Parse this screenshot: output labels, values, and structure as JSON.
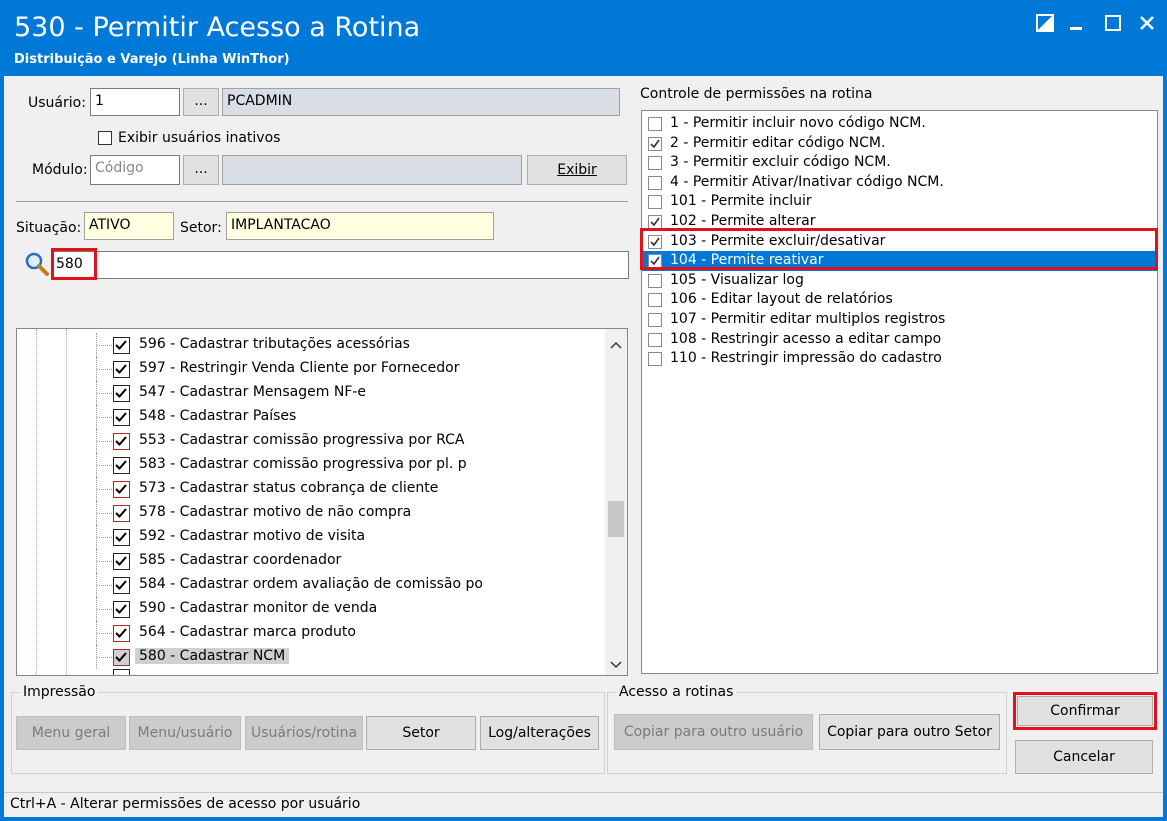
{
  "window": {
    "title": "530 - Permitir Acesso a Rotina",
    "subtitle": "Distribuição e Varejo (Linha WinThor)"
  },
  "usuario": {
    "label": "Usuário:",
    "code": "1",
    "lookup_button": "...",
    "name": "PCADMIN",
    "show_inactive_label": "Exibir usuários inativos",
    "show_inactive_checked": false
  },
  "modulo": {
    "label": "Módulo:",
    "placeholder": "Código",
    "lookup_button": "...",
    "description": "",
    "exibir_button": "Exibir"
  },
  "situacao": {
    "label": "Situação:",
    "value": "ATIVO"
  },
  "setor": {
    "label": "Setor:",
    "value": "IMPLANTACAO"
  },
  "search": {
    "value": "580",
    "icon": "search-icon"
  },
  "tree_items": [
    {
      "label": "596 - Cadastrar tributações acessórias",
      "checked": true,
      "red": false
    },
    {
      "label": "597 - Restringir Venda Cliente por Fornecedor",
      "checked": true,
      "red": false
    },
    {
      "label": "547 - Cadastrar Mensagem NF-e",
      "checked": true,
      "red": false
    },
    {
      "label": "548 - Cadastrar Países",
      "checked": true,
      "red": false
    },
    {
      "label": "553 - Cadastrar comissão progressiva por RCA",
      "checked": true,
      "red": true
    },
    {
      "label": "583 - Cadastrar comissão progressiva por pl. p",
      "checked": true,
      "red": false
    },
    {
      "label": "573 - Cadastrar status cobrança de cliente",
      "checked": true,
      "red": true
    },
    {
      "label": "578 - Cadastrar motivo de não compra",
      "checked": true,
      "red": true
    },
    {
      "label": "592 - Cadastrar motivo de visita",
      "checked": true,
      "red": false
    },
    {
      "label": "585 - Cadastrar coordenador",
      "checked": true,
      "red": false
    },
    {
      "label": "584 - Cadastrar ordem avaliação de comissão po",
      "checked": true,
      "red": false
    },
    {
      "label": "590 - Cadastrar monitor de venda",
      "checked": true,
      "red": false
    },
    {
      "label": "564 - Cadastrar marca produto",
      "checked": true,
      "red": true
    },
    {
      "label": "580 - Cadastrar  NCM",
      "checked": true,
      "red": true,
      "selected": true
    }
  ],
  "permissions": {
    "title": "Controle de permissões na rotina",
    "items": [
      {
        "label": "1 - Permitir incluir novo código NCM.",
        "checked": false
      },
      {
        "label": "2 - Permitir editar código NCM.",
        "checked": true
      },
      {
        "label": "3 - Permitir excluir código NCM.",
        "checked": false
      },
      {
        "label": "4 - Permitir Ativar/Inativar código NCM.",
        "checked": false
      },
      {
        "label": "101 - Permite incluir",
        "checked": false
      },
      {
        "label": "102 - Permite alterar",
        "checked": true
      },
      {
        "label": "103 - Permite excluir/desativar",
        "checked": true
      },
      {
        "label": "104 - Permite reativar",
        "checked": true,
        "selected": true
      },
      {
        "label": "105 - Visualizar log",
        "checked": false
      },
      {
        "label": "106 - Editar layout de relatórios",
        "checked": false
      },
      {
        "label": "107 - Permitir editar multiplos registros",
        "checked": false
      },
      {
        "label": "108 - Restringir acesso a editar campo",
        "checked": false
      },
      {
        "label": "110 - Restringir impressão do cadastro",
        "checked": false
      }
    ]
  },
  "impressao": {
    "title": "Impressão",
    "buttons": [
      "Menu geral",
      "Menu/usuário",
      "Usuários/rotina",
      "Setor",
      "Log/alterações"
    ]
  },
  "acesso": {
    "title": "Acesso a rotinas",
    "buttons": [
      "Copiar para outro usuário",
      "Copiar para outro Setor"
    ]
  },
  "actions": {
    "confirmar": "Confirmar",
    "cancelar": "Cancelar"
  },
  "status_text": "Ctrl+A - Alterar permissões de acesso por usuário",
  "colors": {
    "titlebar": "#0078d7",
    "highlight_box": "#e0121b",
    "selection": "#0078d7"
  }
}
